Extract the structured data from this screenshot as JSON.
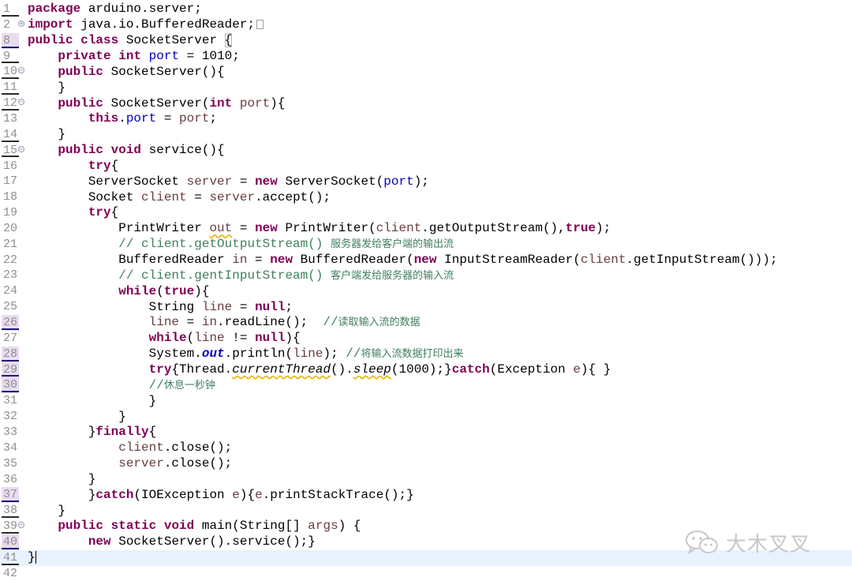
{
  "editor": {
    "line_numbers": [
      "1",
      "2",
      "8",
      "9",
      "10",
      "11",
      "12",
      "13",
      "14",
      "15",
      "16",
      "17",
      "18",
      "19",
      "20",
      "21",
      "22",
      "23",
      "24",
      "25",
      "26",
      "27",
      "28",
      "29",
      "30",
      "31",
      "32",
      "33",
      "34",
      "35",
      "36",
      "37",
      "38",
      "39",
      "40",
      "41",
      "42"
    ],
    "code": {
      "l1": {
        "kw": "package",
        "rest": " arduino.server;"
      },
      "l2": {
        "kw": "import",
        "rest": " java.io.BufferedReader;"
      },
      "l8": {
        "kw1": "public",
        "kw2": "class",
        "name": " SocketServer ",
        "brace": "{"
      },
      "l9": {
        "kw1": "private",
        "kw2": "int",
        "field": "port",
        "rest": " = 1010;"
      },
      "l10": {
        "kw": "public",
        "rest": " SocketServer(){"
      },
      "l11": {
        "rest": "}"
      },
      "l12": {
        "kw": "public",
        "rest1": " SocketServer(",
        "kw2": "int",
        "var": "port",
        "rest2": "){"
      },
      "l13": {
        "kw": "this",
        "dot": ".",
        "field": "port",
        "eq": " = ",
        "var": "port",
        "end": ";"
      },
      "l14": {
        "rest": "}"
      },
      "l15": {
        "kw1": "public",
        "kw2": "void",
        "rest": " service(){"
      },
      "l16": {
        "kw": "try",
        "rest": "{"
      },
      "l17": {
        "t1": "ServerSocket ",
        "var": "server",
        "t2": " = ",
        "kw": "new",
        "t3": " ServerSocket(",
        "field": "port",
        "t4": ");"
      },
      "l18": {
        "t1": "Socket ",
        "v1": "client",
        "t2": " = ",
        "v2": "server",
        "t3": ".accept();"
      },
      "l19": {
        "kw": "try",
        "rest": "{"
      },
      "l20": {
        "t1": "PrintWriter ",
        "var": "out",
        "t2": " = ",
        "kw": "new",
        "t3": " PrintWriter(",
        "v2": "client",
        "t4": ".getOutputStream(),",
        "kw2": "true",
        "t5": ");"
      },
      "l21": {
        "cm": "// client.getOutputStream() ",
        "zh": "服务器发给客户端的输出流"
      },
      "l22": {
        "t1": "BufferedReader ",
        "var": "in",
        "t2": " = ",
        "kw": "new",
        "t3": " BufferedReader(",
        "kw2": "new",
        "t4": " InputStreamReader(",
        "v2": "client",
        "t5": ".getInputStream()));"
      },
      "l23": {
        "cm": "// client.gentInputStream() ",
        "zh": "客户端发给服务器的输入流"
      },
      "l24": {
        "kw": "while",
        "t1": "(",
        "kw2": "true",
        "t2": "){"
      },
      "l25": {
        "t1": "String ",
        "var": "line",
        "t2": " = ",
        "kw": "null",
        "t3": ";"
      },
      "l26": {
        "v1": "line",
        "t1": " = ",
        "v2": "in",
        "t2": ".readLine();  ",
        "cm": "//",
        "zh": "读取输入流的数据"
      },
      "l27": {
        "kw": "while",
        "t1": "(",
        "var": "line",
        "t2": " != ",
        "kw2": "null",
        "t3": "){"
      },
      "l28": {
        "t1": "System.",
        "sf": "out",
        "t2": ".println(",
        "var": "line",
        "t3": "); ",
        "cm": "//",
        "zh": "将输入流数据打印出来"
      },
      "l29": {
        "kw": "try",
        "t1": "{Thread.",
        "s1": "currentThread",
        "t2": "().",
        "s2": "sleep",
        "t3": "(1000);}",
        "kw2": "catch",
        "t4": "(Exception ",
        "var": "e",
        "t5": "){ }"
      },
      "l30": {
        "cm": "//",
        "zh": "休息一秒钟"
      },
      "l31": {
        "rest": "}"
      },
      "l32": {
        "rest": "}"
      },
      "l33": {
        "t1": "}",
        "kw": "finally",
        "t2": "{"
      },
      "l34": {
        "var": "client",
        "rest": ".close();"
      },
      "l35": {
        "var": "server",
        "rest": ".close();"
      },
      "l36": {
        "rest": "}"
      },
      "l37": {
        "t1": "}",
        "kw": "catch",
        "t2": "(IOException ",
        "var": "e",
        "t3": "){",
        "v2": "e",
        "t4": ".printStackTrace();}"
      },
      "l38": {
        "rest": "}"
      },
      "l39": {
        "kw1": "public",
        "kw2": "static",
        "kw3": "void",
        "t1": " main(String[] ",
        "var": "args",
        "t2": ") {"
      },
      "l40": {
        "kw": "new",
        "rest": " SocketServer().service();}"
      },
      "l41": {
        "rest": "}"
      }
    }
  },
  "watermark": {
    "text": "大木叉叉",
    "icon": "wechat-icon"
  }
}
